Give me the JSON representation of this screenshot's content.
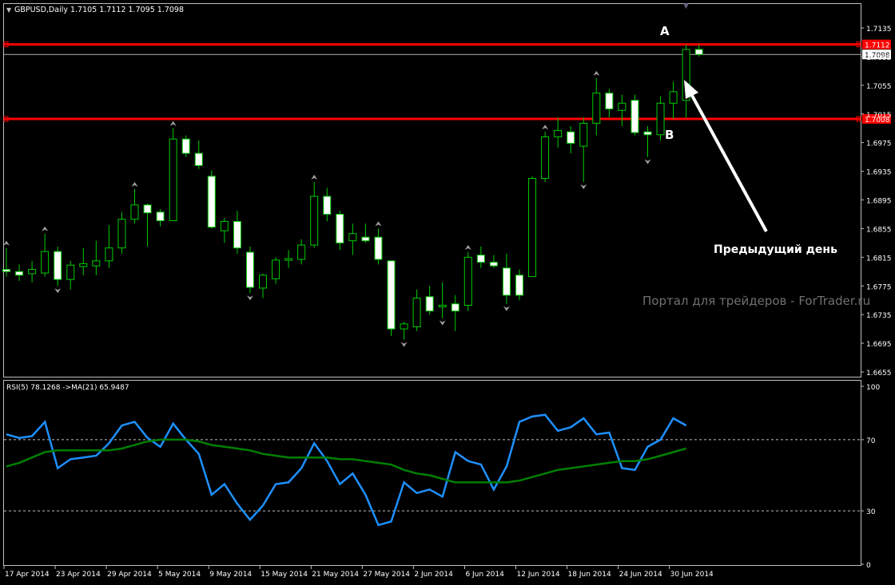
{
  "window": {
    "symbol_header": "GBPUSD,Daily  1.7105 1.7112 1.7095 1.7098",
    "watermark": "Портал для трейдеров - ForTrader.ru",
    "scroll_marker_icon": "triangle-down-icon"
  },
  "annotations": {
    "label_a": "A",
    "label_b": "B",
    "arrow_text": "Предыдущий день"
  },
  "colors": {
    "background": "#000000",
    "frame": "#c0c0c0",
    "candle_bull": "#00cc00",
    "candle_bear_fill": "#ffffff",
    "level_line": "#ff0000",
    "rsi_line": "#1e90ff",
    "ma_line": "#008000",
    "fractal": "#a0a0a0",
    "bid_line": "#b0b0b0"
  },
  "chart_data": [
    {
      "type": "candlestick",
      "title": "GBPUSD,Daily",
      "ylim": [
        1.6655,
        1.7135
      ],
      "y_ticks": [
        "1.7135",
        "1.7095",
        "1.7055",
        "1.7015",
        "1.6975",
        "1.6935",
        "1.6895",
        "1.6855",
        "1.6815",
        "1.6775",
        "1.6735",
        "1.6695",
        "1.6655"
      ],
      "x_ticks": [
        "17 Apr 2014",
        "23 Apr 2014",
        "29 Apr 2014",
        "5 May 2014",
        "9 May 2014",
        "15 May 2014",
        "21 May 2014",
        "27 May 2014",
        "2 Jun 2014",
        "6 Jun 2014",
        "12 Jun 2014",
        "18 Jun 2014",
        "24 Jun 2014",
        "30 Jun 2014"
      ],
      "levels": [
        {
          "price": 1.7112,
          "label": "1.7112",
          "color": "#ff0000"
        },
        {
          "price": 1.7008,
          "label": "1.7008",
          "color": "#ff0000"
        }
      ],
      "bid_price": {
        "price": 1.7098,
        "label": "1.7098"
      },
      "candles": [
        {
          "o": 1.6798,
          "h": 1.6828,
          "l": 1.6788,
          "c": 1.6795
        },
        {
          "o": 1.6795,
          "h": 1.6805,
          "l": 1.6782,
          "c": 1.679
        },
        {
          "o": 1.6792,
          "h": 1.681,
          "l": 1.678,
          "c": 1.6798
        },
        {
          "o": 1.6793,
          "h": 1.6848,
          "l": 1.6788,
          "c": 1.6823
        },
        {
          "o": 1.6823,
          "h": 1.683,
          "l": 1.6775,
          "c": 1.6784
        },
        {
          "o": 1.6784,
          "h": 1.681,
          "l": 1.677,
          "c": 1.6804
        },
        {
          "o": 1.6802,
          "h": 1.6828,
          "l": 1.679,
          "c": 1.6806
        },
        {
          "o": 1.6803,
          "h": 1.6838,
          "l": 1.679,
          "c": 1.681
        },
        {
          "o": 1.681,
          "h": 1.686,
          "l": 1.68,
          "c": 1.6828
        },
        {
          "o": 1.6828,
          "h": 1.6878,
          "l": 1.682,
          "c": 1.6868
        },
        {
          "o": 1.6868,
          "h": 1.691,
          "l": 1.6862,
          "c": 1.6888
        },
        {
          "o": 1.6888,
          "h": 1.689,
          "l": 1.683,
          "c": 1.6877
        },
        {
          "o": 1.6878,
          "h": 1.6882,
          "l": 1.6858,
          "c": 1.6866
        },
        {
          "o": 1.6866,
          "h": 1.6995,
          "l": 1.6866,
          "c": 1.698
        },
        {
          "o": 1.698,
          "h": 1.6985,
          "l": 1.6955,
          "c": 1.696
        },
        {
          "o": 1.696,
          "h": 1.6978,
          "l": 1.6938,
          "c": 1.6943
        },
        {
          "o": 1.6928,
          "h": 1.6936,
          "l": 1.6855,
          "c": 1.6857
        },
        {
          "o": 1.6852,
          "h": 1.687,
          "l": 1.6835,
          "c": 1.6865
        },
        {
          "o": 1.6865,
          "h": 1.688,
          "l": 1.682,
          "c": 1.6828
        },
        {
          "o": 1.6822,
          "h": 1.683,
          "l": 1.6765,
          "c": 1.6773
        },
        {
          "o": 1.6772,
          "h": 1.6792,
          "l": 1.6758,
          "c": 1.679
        },
        {
          "o": 1.6785,
          "h": 1.6815,
          "l": 1.6778,
          "c": 1.6811
        },
        {
          "o": 1.6811,
          "h": 1.6825,
          "l": 1.68,
          "c": 1.6813
        },
        {
          "o": 1.6812,
          "h": 1.684,
          "l": 1.6805,
          "c": 1.6832
        },
        {
          "o": 1.6832,
          "h": 1.692,
          "l": 1.6828,
          "c": 1.69
        },
        {
          "o": 1.69,
          "h": 1.6912,
          "l": 1.6865,
          "c": 1.6875
        },
        {
          "o": 1.6875,
          "h": 1.688,
          "l": 1.6825,
          "c": 1.6835
        },
        {
          "o": 1.6838,
          "h": 1.6862,
          "l": 1.6818,
          "c": 1.6848
        },
        {
          "o": 1.6843,
          "h": 1.6862,
          "l": 1.6835,
          "c": 1.6838
        },
        {
          "o": 1.6843,
          "h": 1.6855,
          "l": 1.6805,
          "c": 1.6812
        },
        {
          "o": 1.681,
          "h": 1.681,
          "l": 1.6705,
          "c": 1.6715
        },
        {
          "o": 1.6715,
          "h": 1.6725,
          "l": 1.67,
          "c": 1.6722
        },
        {
          "o": 1.6718,
          "h": 1.677,
          "l": 1.6712,
          "c": 1.6758
        },
        {
          "o": 1.676,
          "h": 1.6775,
          "l": 1.6735,
          "c": 1.674
        },
        {
          "o": 1.6746,
          "h": 1.678,
          "l": 1.673,
          "c": 1.6748
        },
        {
          "o": 1.675,
          "h": 1.6762,
          "l": 1.6712,
          "c": 1.674
        },
        {
          "o": 1.6748,
          "h": 1.6822,
          "l": 1.674,
          "c": 1.6815
        },
        {
          "o": 1.6818,
          "h": 1.683,
          "l": 1.68,
          "c": 1.6808
        },
        {
          "o": 1.6808,
          "h": 1.6818,
          "l": 1.68,
          "c": 1.6803
        },
        {
          "o": 1.68,
          "h": 1.682,
          "l": 1.675,
          "c": 1.6762
        },
        {
          "o": 1.679,
          "h": 1.6798,
          "l": 1.6755,
          "c": 1.6762
        },
        {
          "o": 1.6788,
          "h": 1.6928,
          "l": 1.6788,
          "c": 1.6925
        },
        {
          "o": 1.6925,
          "h": 1.699,
          "l": 1.692,
          "c": 1.6983
        },
        {
          "o": 1.6983,
          "h": 1.701,
          "l": 1.6968,
          "c": 1.6992
        },
        {
          "o": 1.699,
          "h": 1.6998,
          "l": 1.696,
          "c": 1.6974
        },
        {
          "o": 1.697,
          "h": 1.701,
          "l": 1.692,
          "c": 1.7002
        },
        {
          "o": 1.7002,
          "h": 1.7065,
          "l": 1.6985,
          "c": 1.7044
        },
        {
          "o": 1.7044,
          "h": 1.705,
          "l": 1.701,
          "c": 1.7022
        },
        {
          "o": 1.702,
          "h": 1.7042,
          "l": 1.6998,
          "c": 1.703
        },
        {
          "o": 1.7034,
          "h": 1.7042,
          "l": 1.6985,
          "c": 1.6989
        },
        {
          "o": 1.699,
          "h": 1.6998,
          "l": 1.6955,
          "c": 1.6986
        },
        {
          "o": 1.6986,
          "h": 1.704,
          "l": 1.6978,
          "c": 1.703
        },
        {
          "o": 1.703,
          "h": 1.706,
          "l": 1.7008,
          "c": 1.7046
        },
        {
          "o": 1.7034,
          "h": 1.7112,
          "l": 1.701,
          "c": 1.7105
        },
        {
          "o": 1.7105,
          "h": 1.7112,
          "l": 1.7095,
          "c": 1.7098
        }
      ],
      "fractals": [
        {
          "i": 0,
          "dir": "up"
        },
        {
          "i": 3,
          "dir": "up"
        },
        {
          "i": 4,
          "dir": "down"
        },
        {
          "i": 10,
          "dir": "up"
        },
        {
          "i": 13,
          "dir": "up"
        },
        {
          "i": 19,
          "dir": "down"
        },
        {
          "i": 24,
          "dir": "up"
        },
        {
          "i": 29,
          "dir": "up"
        },
        {
          "i": 31,
          "dir": "down"
        },
        {
          "i": 34,
          "dir": "down"
        },
        {
          "i": 36,
          "dir": "up"
        },
        {
          "i": 39,
          "dir": "down"
        },
        {
          "i": 42,
          "dir": "up"
        },
        {
          "i": 45,
          "dir": "down"
        },
        {
          "i": 46,
          "dir": "up"
        },
        {
          "i": 50,
          "dir": "down"
        }
      ]
    },
    {
      "type": "line",
      "title": "RSI(5) 78.1268  ->MA(21) 65.9487",
      "ylim": [
        0,
        100
      ],
      "y_ticks": [
        "100",
        "70",
        "30",
        "0"
      ],
      "levels": [
        70,
        30
      ],
      "series": [
        {
          "name": "RSI(5)",
          "color": "#1e90ff",
          "values": [
            73,
            71,
            72,
            80,
            54,
            59,
            60,
            61,
            68,
            78,
            80,
            71,
            66,
            79,
            70,
            62,
            39,
            45,
            34,
            25,
            33,
            45,
            46,
            54,
            68,
            58,
            45,
            51,
            39,
            22,
            24,
            46,
            40,
            42,
            38,
            63,
            58,
            56,
            42,
            55,
            80,
            83,
            84,
            75,
            77,
            82,
            73,
            74,
            54,
            53,
            66,
            70,
            82,
            78
          ]
        },
        {
          "name": "MA(21)",
          "color": "#008000",
          "values": [
            55,
            57,
            60,
            63,
            64,
            64,
            64,
            64,
            64,
            65,
            67,
            69,
            70,
            70,
            70,
            69,
            67,
            66,
            65,
            64,
            62,
            61,
            60,
            60,
            60,
            60,
            59,
            59,
            58,
            57,
            56,
            53,
            51,
            50,
            48,
            46,
            46,
            46,
            46,
            46,
            47,
            49,
            51,
            53,
            54,
            55,
            56,
            57,
            58,
            58,
            59,
            61,
            63,
            65
          ]
        }
      ]
    }
  ]
}
